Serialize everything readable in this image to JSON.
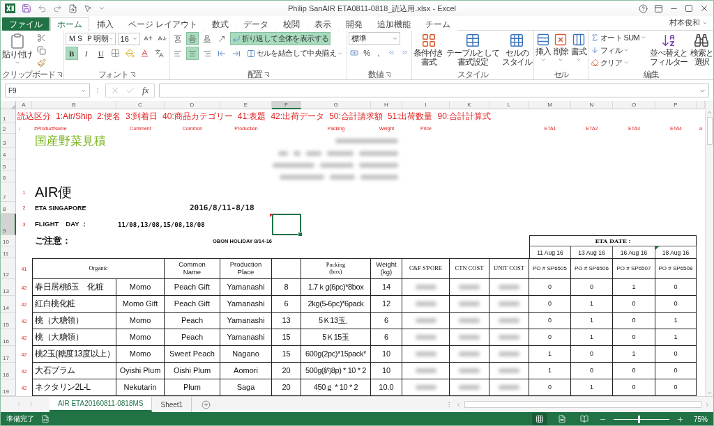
{
  "window": {
    "title": "Philip SanAIR ETA0811-0818_読込用.xlsx - Excel",
    "user": "村本俊和"
  },
  "ribbon_tabs": [
    {
      "label": "ファイル",
      "kind": "file",
      "selected": false
    },
    {
      "label": "ホーム",
      "kind": "tab",
      "selected": true
    },
    {
      "label": "挿入",
      "kind": "tab",
      "selected": false
    },
    {
      "label": "ページ レイアウト",
      "kind": "tab",
      "selected": false
    },
    {
      "label": "数式",
      "kind": "tab",
      "selected": false
    },
    {
      "label": "データ",
      "kind": "tab",
      "selected": false
    },
    {
      "label": "校閲",
      "kind": "tab",
      "selected": false
    },
    {
      "label": "表示",
      "kind": "tab",
      "selected": false
    },
    {
      "label": "開発",
      "kind": "tab",
      "selected": false
    },
    {
      "label": "追加機能",
      "kind": "tab",
      "selected": false
    },
    {
      "label": "チーム",
      "kind": "tab",
      "selected": false
    }
  ],
  "ribbon": {
    "clipboard": {
      "label": "クリップボード",
      "paste": "貼り付け"
    },
    "font": {
      "label": "フォント",
      "font": "ＭＳ Ｐ明朝",
      "size": "16",
      "styles": [
        {
          "label": "B",
          "kind": "bold",
          "selected": true
        },
        {
          "label": "I",
          "kind": "italic",
          "selected": false
        },
        {
          "label": "U",
          "kind": "underline",
          "selected": false
        }
      ]
    },
    "alignment": {
      "label": "配置",
      "vertical": [
        {
          "selected": false
        },
        {
          "selected": true
        },
        {
          "selected": false
        }
      ],
      "horizontal": [
        {
          "selected": false
        },
        {
          "selected": true
        },
        {
          "selected": false
        }
      ],
      "wrap": {
        "label": "折り返して全体を表示する",
        "selected": true
      },
      "merge": "セルを結合して中央揃え"
    },
    "number": {
      "label": "数値",
      "format": "標準",
      "symbols": [
        "%",
        ","
      ]
    },
    "styles": {
      "label": "スタイル",
      "buttons": [
        {
          "lines": [
            "条件付き",
            "書式"
          ]
        },
        {
          "lines": [
            "テーブルとして",
            "書式設定"
          ]
        },
        {
          "lines": [
            "セルの",
            "スタイル"
          ]
        }
      ]
    },
    "cells": {
      "label": "セル",
      "buttons": [
        "挿入",
        "削除",
        "書式"
      ]
    },
    "editing": {
      "label": "編集",
      "small": [
        "オート SUM",
        "フィル",
        "クリア"
      ],
      "buttons": [
        {
          "lines": [
            "並べ替えと",
            "フィルター"
          ]
        },
        {
          "lines": [
            "検索と",
            "選択"
          ]
        }
      ]
    }
  },
  "formula_bar": {
    "name_box": "F9",
    "function_label": "fx"
  },
  "sheet": {
    "columns": [
      {
        "label": "A",
        "field": "↓",
        "selected": false
      },
      {
        "label": "B",
        "field": "#ProductName",
        "selected": false
      },
      {
        "label": "C",
        "field": "Comment",
        "selected": false
      },
      {
        "label": "D",
        "field": "Common",
        "selected": false
      },
      {
        "label": "E",
        "field": "Production",
        "selected": false
      },
      {
        "label": "F",
        "selected": true
      },
      {
        "label": "G",
        "field": "Packing",
        "selected": false
      },
      {
        "label": "H",
        "field": "Weight",
        "selected": false
      },
      {
        "label": "I",
        "field": "Price",
        "selected": false
      },
      {
        "label": "K",
        "selected": false
      },
      {
        "label": "L",
        "selected": false
      },
      {
        "label": "M",
        "field": "ETA1",
        "selected": false
      },
      {
        "label": "N",
        "field": "ETA2",
        "selected": false
      },
      {
        "label": "O",
        "field": "ETA3",
        "selected": false
      },
      {
        "label": "P",
        "field": "ETA4",
        "selected": false
      },
      {
        "field": "a"
      }
    ],
    "rows": [
      {
        "label": "1",
        "selected": false
      },
      {
        "label": "2",
        "selected": false
      },
      {
        "label": "3",
        "selected": false
      },
      {
        "label": "4",
        "selected": false
      },
      {
        "label": "5",
        "selected": false
      },
      {
        "label": "6",
        "selected": false
      },
      {
        "label": "7",
        "selected": false
      },
      {
        "label": "8",
        "selected": false
      },
      {
        "label": "9",
        "selected": true
      },
      {
        "label": "10",
        "selected": false
      },
      {
        "label": "11",
        "selected": false
      },
      {
        "label": "12",
        "selected": false
      },
      {
        "label": "13",
        "selected": false
      },
      {
        "label": "14",
        "selected": false
      },
      {
        "label": "15",
        "selected": false
      },
      {
        "label": "16",
        "selected": false
      },
      {
        "label": "17",
        "selected": false
      },
      {
        "label": "18",
        "selected": false
      },
      {
        "label": "19",
        "selected": false
      }
    ],
    "legend": [
      "読込区分",
      "1:Air/Ship",
      "2:便名",
      "3:到着日",
      "40:商品カテゴリー",
      "41:表題",
      "42:出荷データ",
      "50:合計請求額",
      "51:出荷数量",
      "90:合計計算式"
    ],
    "title": "国産野菜見積",
    "heading": {
      "marker": "1",
      "label": "AIR便"
    },
    "eta_line": {
      "marker": "2",
      "label": "ETA SINGAPORE",
      "value": "2016/8/11-8/18"
    },
    "flight_line": {
      "marker": "3",
      "label": "FLIGHT　DAY ：",
      "value": "11/08,13/08,15/08,18/08"
    },
    "notice": {
      "label": "ご注意：",
      "value": "OBON HOLIDAY 8/14-16"
    },
    "cursor": {
      "comment": true
    },
    "eta_box": {
      "title": "ETA DATE :",
      "dates": [
        {
          "label": "11 Aug 16",
          "flagged": false
        },
        {
          "label": "13 Aug 16",
          "flagged": false
        },
        {
          "label": "16 Aug 16",
          "flagged": false
        },
        {
          "label": "18 Aug 16",
          "flagged": true
        }
      ]
    },
    "table": {
      "marker": "41",
      "headers": [
        {
          "label": "Organic",
          "kind": "double"
        },
        {
          "label": "Common\nName",
          "kind": "sans"
        },
        {
          "label": "Production\nPlace",
          "kind": "sans"
        },
        {
          "kind": "blank"
        },
        {
          "label": "Packing\n(box)",
          "kind": "serif"
        },
        {
          "label": "Weight\n(kg)",
          "kind": "sans"
        },
        {
          "label": "C&F S'PORE",
          "kind": "serif"
        },
        {
          "label": "CTN COST",
          "kind": "serif"
        },
        {
          "label": "UNIT COST",
          "kind": "serif"
        },
        {
          "label": "PO # SP6505",
          "kind": "sans"
        },
        {
          "label": "PO # SP6506",
          "kind": "sans"
        },
        {
          "label": "PO # SP6507",
          "kind": "sans"
        },
        {
          "label": "PO # SP6508",
          "kind": "sans"
        }
      ],
      "rows": [
        {
          "marker": "42",
          "cells": [
            "春日居桃6玉　化粧",
            "Momo",
            "Peach Gift",
            "Yamanashi",
            "8",
            "1.7ｋg(6pc)*8box",
            "14"
          ],
          "po": [
            "0",
            "0",
            "1",
            "0"
          ]
        },
        {
          "marker": "42",
          "cells": [
            "紅白桃化粧",
            "Momo Gift",
            "Peach Gift",
            "Yamanashi",
            "6",
            "2kg(5-6pc)*6pack",
            "12"
          ],
          "po": [
            "0",
            "1",
            "0",
            "0"
          ]
        },
        {
          "marker": "42",
          "cells": [
            "桃（大糖領）",
            "Momo",
            "Peach",
            "Yamanashi",
            "13",
            "5Ｋ13玉、",
            "6"
          ],
          "po": [
            "0",
            "1",
            "0",
            "1"
          ]
        },
        {
          "marker": "42",
          "cells": [
            "桃（大糖領）",
            "Momo",
            "Peach",
            "Yamanashi",
            "15",
            "5Ｋ15玉",
            "6"
          ],
          "po": [
            "0",
            "1",
            "0",
            "1"
          ]
        },
        {
          "marker": "42",
          "cells": [
            "桃2玉(糖度13度以上）",
            "Momo",
            "Sweet Peach",
            "Nagano",
            "15",
            "600g(2pc)*15pack*",
            "10"
          ],
          "po": [
            "1",
            "0",
            "1",
            "0"
          ]
        },
        {
          "marker": "42",
          "cells": [
            "大石プラム",
            "Oyishi Plum",
            "Oishi Plum",
            "Aomori",
            "20",
            "500g(約8p) * 10 * 2",
            "10"
          ],
          "po": [
            "1",
            "0",
            "0",
            "0"
          ]
        },
        {
          "marker": "42",
          "cells": [
            "ネクタリン2L-L",
            "Nekutarin",
            "Plum",
            "Saga",
            "20",
            "450ｇ * 10 * 2",
            "10.0"
          ],
          "po": [
            "0",
            "1",
            "0",
            "0"
          ]
        }
      ]
    }
  },
  "sheet_tabs": [
    {
      "label": "AIR ETA20160811-0818MS",
      "selected": true
    },
    {
      "label": "Sheet1",
      "selected": false
    }
  ],
  "status_bar": {
    "status": "準備完了",
    "views": [
      {
        "selected": true
      },
      {
        "selected": false
      },
      {
        "selected": false
      }
    ],
    "zoom": {
      "label": "75%",
      "level": 0.45
    }
  }
}
